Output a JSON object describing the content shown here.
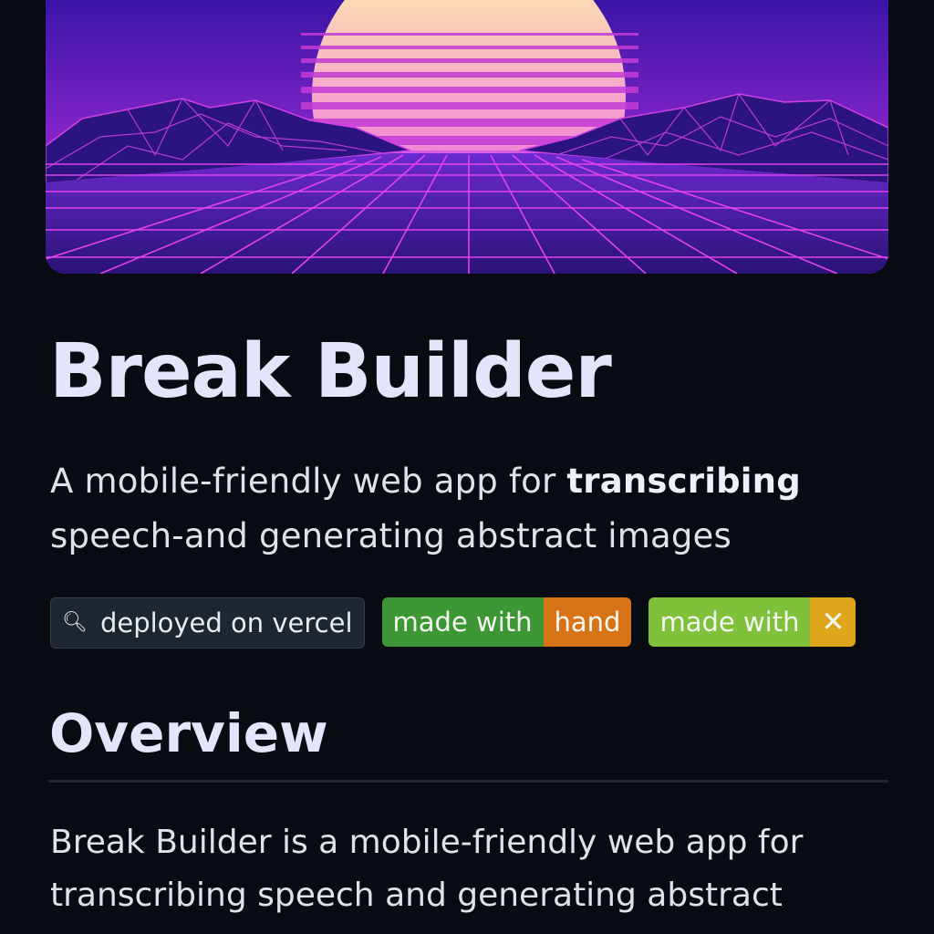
{
  "header": {
    "hero_image": "synthwave-sunset-grid"
  },
  "title": "Break Builder",
  "subtitle": {
    "before": "A mobile-friendly web app for ",
    "emphasis": "transcribing",
    "after": " speech-and generating abstract images"
  },
  "badges": {
    "vercel": {
      "icon": "search-icon",
      "label": "deployed on vercel"
    },
    "hand": {
      "left": "made with",
      "right": "hand",
      "left_color": "#3d9735",
      "right_color": "#d87418"
    },
    "x": {
      "left": "made with",
      "right": "✕",
      "left_color": "#7fc13a",
      "right_color": "#dfa51b"
    }
  },
  "overview": {
    "heading": "Overview",
    "text": "Break Builder is a mobile-friendly web app for transcribing speech and generating abstract"
  },
  "colors": {
    "background": "#080b12",
    "heading": "#e4e5fa",
    "sky_top": "#3a15a5",
    "sky_bottom": "#d83ce0",
    "sun_top": "#fff7a3",
    "sun_bottom": "#e84fe6"
  }
}
